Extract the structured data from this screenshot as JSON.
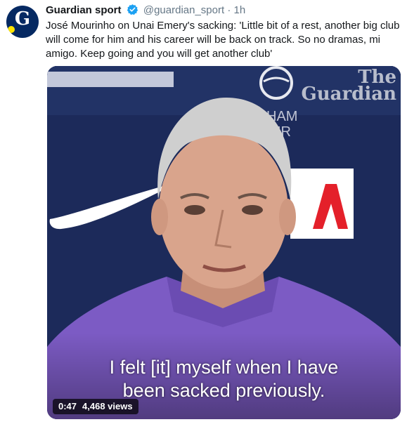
{
  "account": {
    "name": "Guardian sport",
    "handle": "@guardian_sport",
    "separator": "·",
    "time": "1h",
    "avatar_letter": "G"
  },
  "tweet": {
    "text": "José Mourinho on Unai Emery's sacking: 'Little bit of a rest, another big club will come for him and his career will be back on track. So no dramas, mi amigo. Keep going and you will get another club'"
  },
  "video": {
    "watermark_line1": "The",
    "watermark_line2": "Guardian",
    "subtitle_line1": "I felt [it] myself when I have",
    "subtitle_line2": "been sacked previously.",
    "duration": "0:47",
    "views": "4,468 views"
  },
  "colors": {
    "verified": "#1da1f2",
    "brand_navy": "#052962",
    "kit_purple": "#7c5bc4"
  }
}
